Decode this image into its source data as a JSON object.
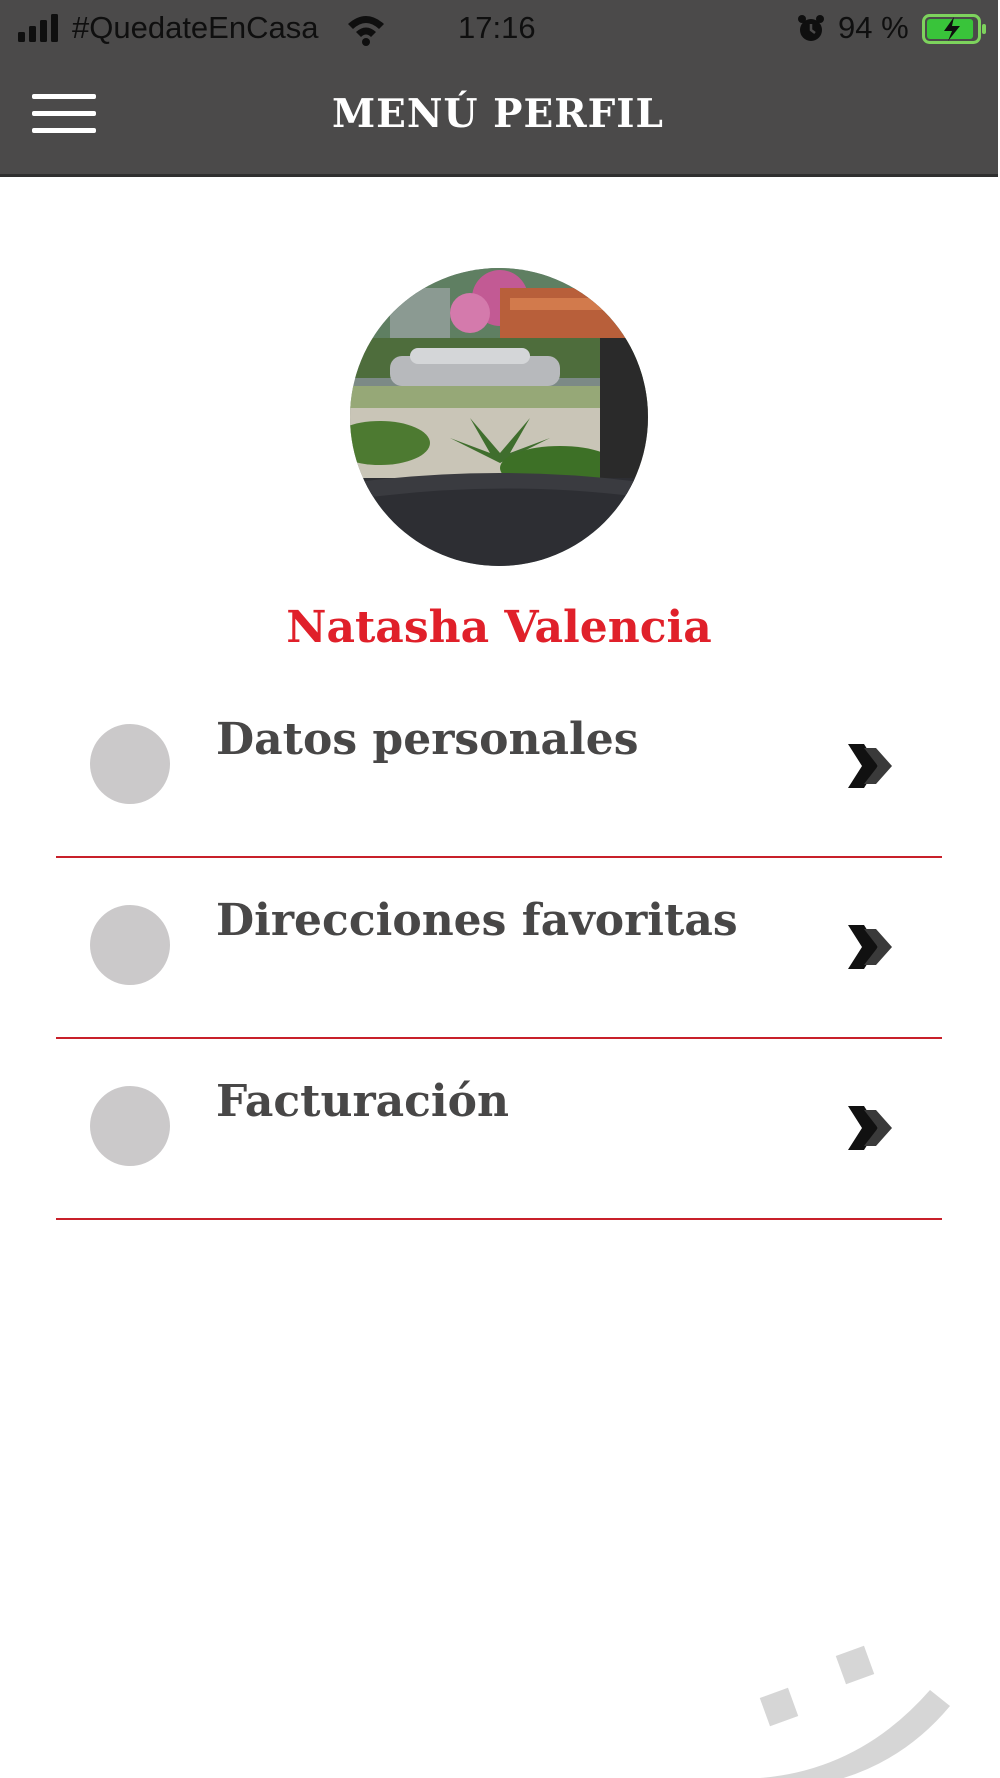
{
  "status_bar": {
    "carrier": "#QuedateEnCasa",
    "time": "17:16",
    "battery_percent": "94 %",
    "battery_level": 0.94,
    "icons": [
      "signal-icon",
      "wifi-icon",
      "alarm-icon",
      "battery-charging-icon"
    ]
  },
  "header": {
    "title": "MENÚ PERFIL",
    "menu_icon": "hamburger-icon",
    "background_color": "#4b4a4a"
  },
  "profile": {
    "name": "Natasha Valencia",
    "name_color": "#e0202a"
  },
  "menu": {
    "items": [
      {
        "label": "Datos personales",
        "icon": "chevron-double-right-icon"
      },
      {
        "label": "Direcciones favoritas",
        "icon": "chevron-double-right-icon"
      },
      {
        "label": "Facturación",
        "icon": "chevron-double-right-icon"
      }
    ],
    "divider_color": "#c8202a"
  },
  "decor": {
    "watermark_icon": "smiley-logo-icon"
  }
}
